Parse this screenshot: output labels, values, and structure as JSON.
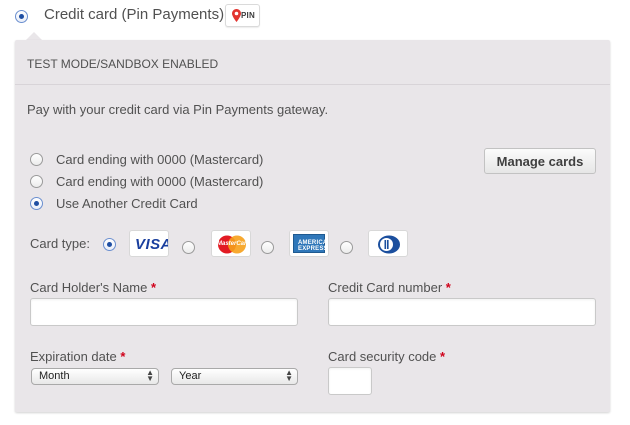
{
  "payment_method": {
    "label": "Credit card (Pin Payments)",
    "logo_text": "PIN",
    "selected": true
  },
  "panel": {
    "test_mode_text": "TEST MODE/SANDBOX ENABLED",
    "description": "Pay with your credit card via Pin Payments gateway."
  },
  "saved_cards": [
    {
      "label": "Card ending with 0000 (Mastercard)",
      "selected": false
    },
    {
      "label": "Card ending with 0000 (Mastercard)",
      "selected": false
    },
    {
      "label": "Use Another Credit Card",
      "selected": true
    }
  ],
  "manage_cards_label": "Manage cards",
  "card_type": {
    "label": "Card type:",
    "options": [
      {
        "name": "visa",
        "logo_text": "VISA",
        "selected": true
      },
      {
        "name": "mastercard",
        "logo_text": "MasterCard",
        "selected": false
      },
      {
        "name": "amex",
        "logo_text": "AMERICAN EXPRESS",
        "selected": false
      },
      {
        "name": "diners",
        "logo_text": "",
        "selected": false
      }
    ]
  },
  "fields": {
    "holder_name": {
      "label": "Card Holder's Name",
      "required_mark": "*",
      "value": ""
    },
    "card_number": {
      "label": "Credit Card number",
      "required_mark": "*",
      "value": ""
    },
    "expiration": {
      "label": "Expiration date",
      "required_mark": "*",
      "month_value": "Month",
      "year_value": "Year"
    },
    "security_code": {
      "label": "Card security code",
      "required_mark": "*",
      "value": ""
    }
  },
  "colors": {
    "panel_bg": "#e9e6e9",
    "required": "#d0021b",
    "visa_blue": "#1a3f9e",
    "amex_blue": "#2f77b9",
    "radio_selected": "#1f4fa3"
  }
}
